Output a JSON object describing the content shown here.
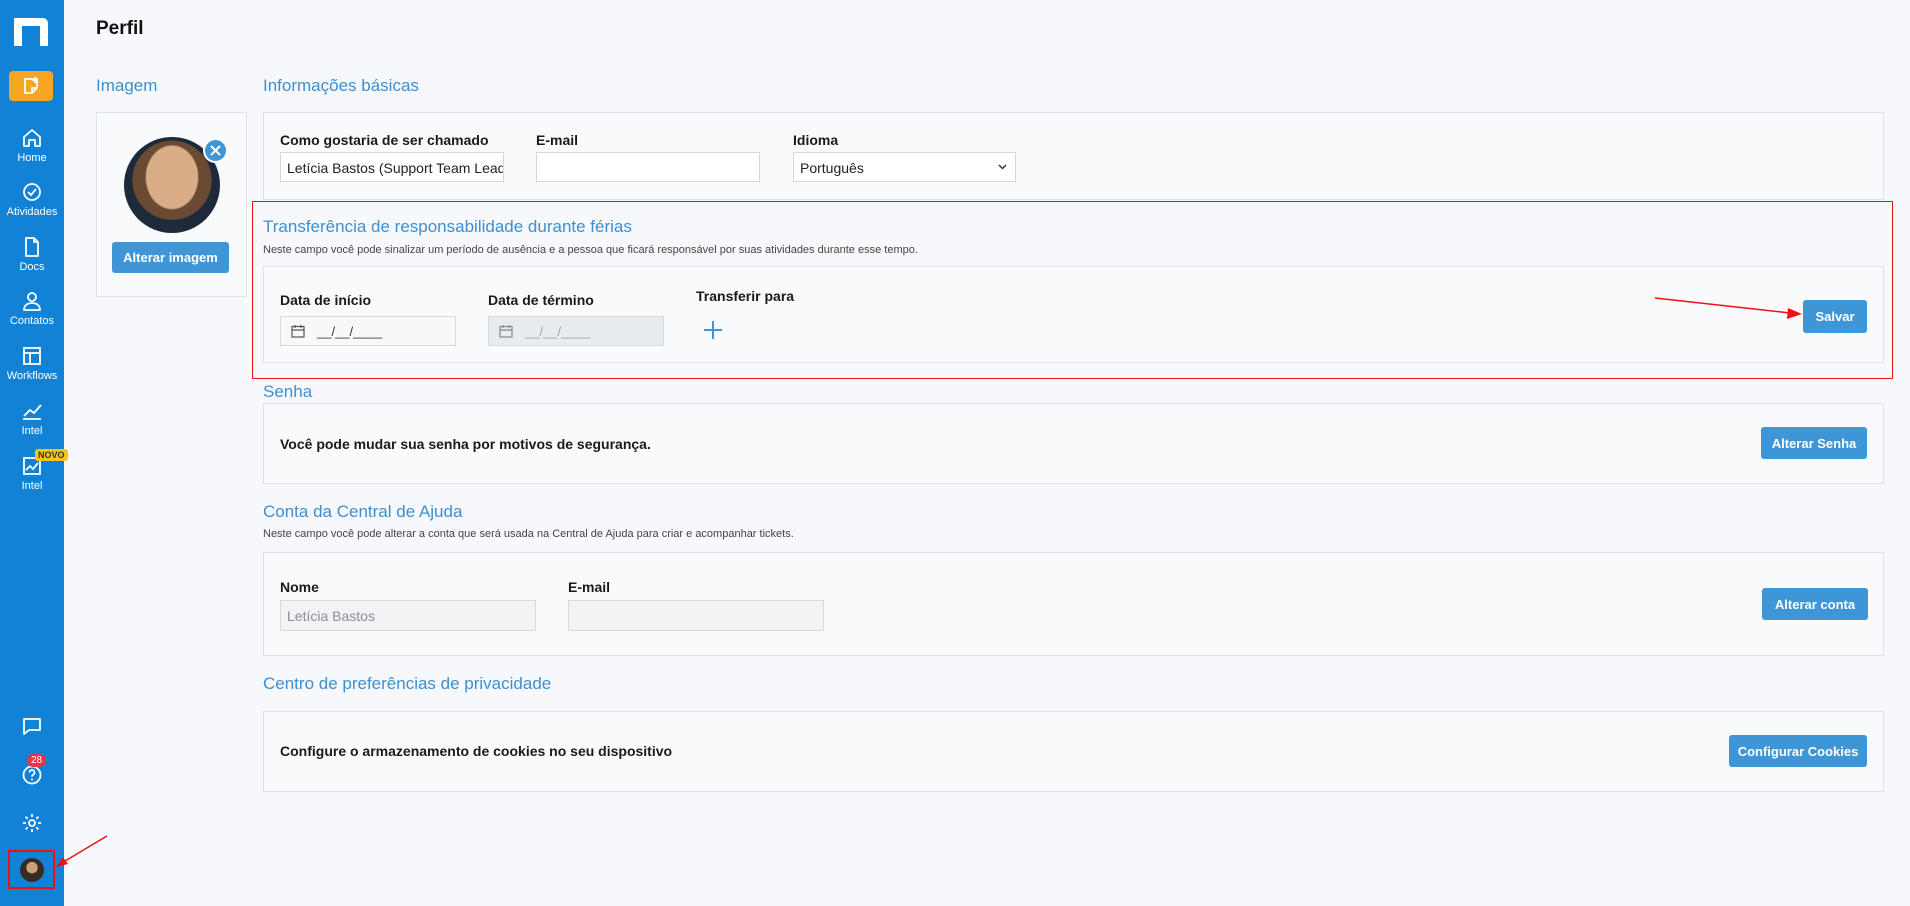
{
  "colors": {
    "sidebar": "#1282d6",
    "accent": "#3f96d6",
    "orange": "#f5a623",
    "highlight": "#e11111"
  },
  "page": {
    "title": "Perfil"
  },
  "sidebar": {
    "items": [
      {
        "label": "Home",
        "icon": "home-icon"
      },
      {
        "label": "Atividades",
        "icon": "check-circle-icon"
      },
      {
        "label": "Docs",
        "icon": "document-icon"
      },
      {
        "label": "Contatos",
        "icon": "user-icon"
      },
      {
        "label": "Workflows",
        "icon": "workflow-icon"
      },
      {
        "label": "Intel",
        "icon": "chart-line-icon"
      },
      {
        "label": "Intel",
        "icon": "chart-image-icon",
        "badge": "NOVO"
      }
    ],
    "help_count": "28"
  },
  "image_section": {
    "title": "Imagem",
    "change_button": "Alterar imagem"
  },
  "basic_info": {
    "title": "Informações básicas",
    "name_label": "Como gostaria de ser chamado",
    "name_value": "Letícia Bastos (Support Team Lead -",
    "email_label": "E-mail",
    "email_value": "",
    "language_label": "Idioma",
    "language_value": "Português"
  },
  "vacation": {
    "title": "Transferência de responsabilidade durante férias",
    "description": "Neste campo você pode sinalizar um período de ausência e a pessoa que ficará responsável por suas atividades durante esse tempo.",
    "start_label": "Data de início",
    "start_value": "__/__/____",
    "end_label": "Data de término",
    "end_value": "__/__/____",
    "transfer_label": "Transferir para",
    "save_button": "Salvar"
  },
  "password": {
    "title": "Senha",
    "text": "Você pode mudar sua senha por motivos de segurança.",
    "button": "Alterar Senha"
  },
  "help_center": {
    "title": "Conta da Central de Ajuda",
    "description": "Neste campo você pode alterar a conta que será usada na Central de Ajuda para criar e acompanhar tickets.",
    "name_label": "Nome",
    "name_value": "Letícia Bastos",
    "email_label": "E-mail",
    "email_value": "",
    "button": "Alterar conta"
  },
  "privacy": {
    "title": "Centro de preferências de privacidade",
    "text": "Configure o armazenamento de cookies no seu dispositivo",
    "button": "Configurar Cookies"
  }
}
